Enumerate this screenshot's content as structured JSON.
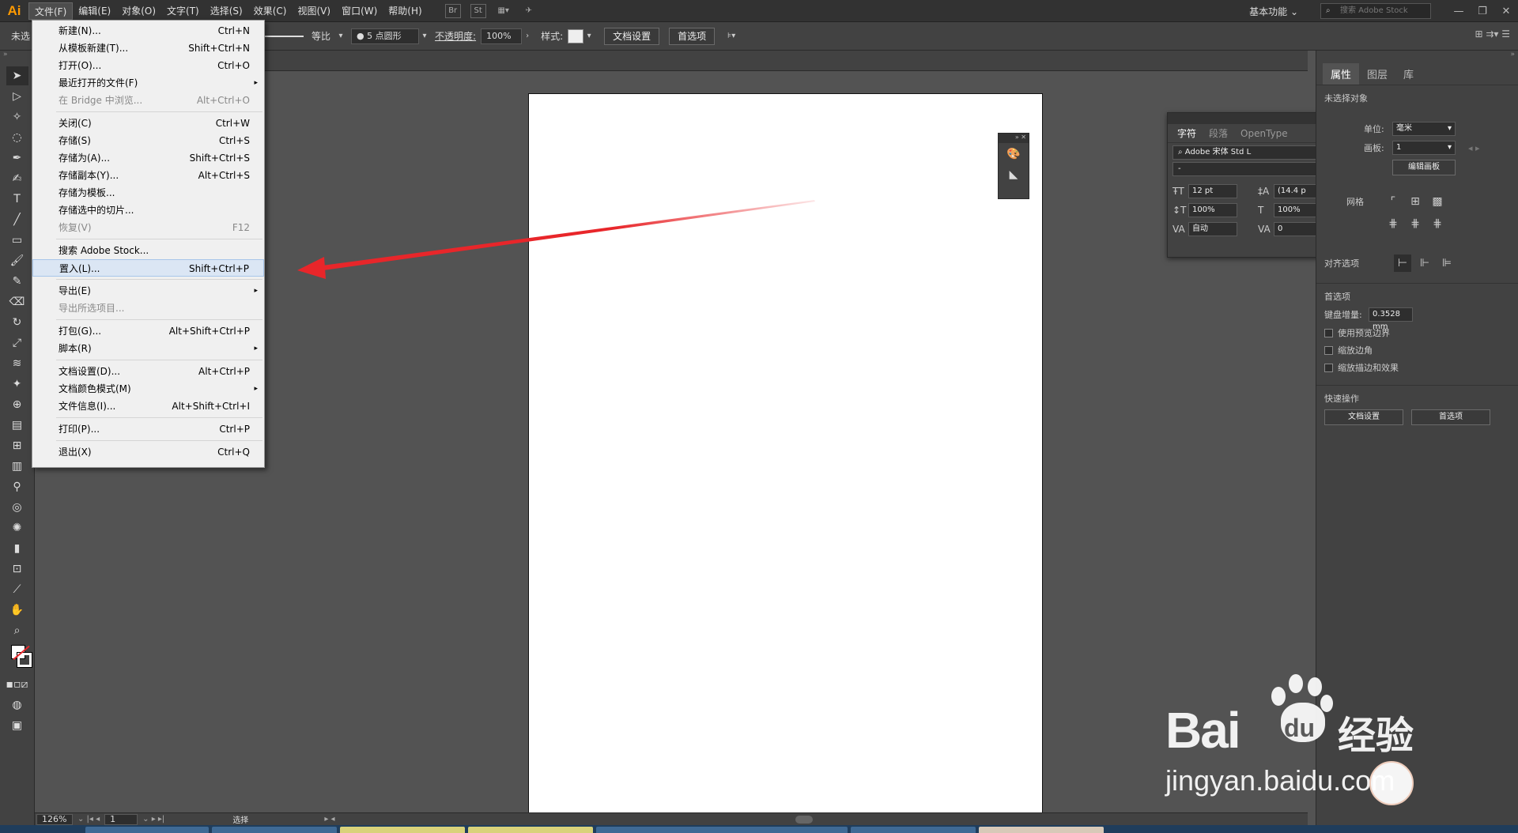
{
  "app": {
    "logo": "Ai"
  },
  "menubar": {
    "items": [
      "文件(F)",
      "编辑(E)",
      "对象(O)",
      "文字(T)",
      "选择(S)",
      "效果(C)",
      "视图(V)",
      "窗口(W)",
      "帮助(H)"
    ],
    "icons": [
      "Br",
      "St"
    ],
    "workspace": "基本功能",
    "stock_search_placeholder": "搜索 Adobe Stock"
  },
  "controlbar": {
    "no_selection": "未选",
    "stroke_profile": "等比",
    "brush": "5 点圆形",
    "opacity_label": "不透明度:",
    "opacity_value": "100%",
    "style_label": "样式:",
    "doc_setup": "文档设置",
    "prefs": "首选项"
  },
  "file_menu": {
    "groups": [
      [
        {
          "label": "新建(N)...",
          "shortcut": "Ctrl+N"
        },
        {
          "label": "从模板新建(T)...",
          "shortcut": "Shift+Ctrl+N"
        },
        {
          "label": "打开(O)...",
          "shortcut": "Ctrl+O"
        },
        {
          "label": "最近打开的文件(F)",
          "shortcut": "",
          "submenu": true
        },
        {
          "label": "在 Bridge 中浏览...",
          "shortcut": "Alt+Ctrl+O",
          "disabled": true
        }
      ],
      [
        {
          "label": "关闭(C)",
          "shortcut": "Ctrl+W"
        },
        {
          "label": "存储(S)",
          "shortcut": "Ctrl+S"
        },
        {
          "label": "存储为(A)...",
          "shortcut": "Shift+Ctrl+S"
        },
        {
          "label": "存储副本(Y)...",
          "shortcut": "Alt+Ctrl+S"
        },
        {
          "label": "存储为模板...",
          "shortcut": ""
        },
        {
          "label": "存储选中的切片...",
          "shortcut": ""
        },
        {
          "label": "恢复(V)",
          "shortcut": "F12",
          "disabled": true
        }
      ],
      [
        {
          "label": "搜索 Adobe Stock...",
          "shortcut": ""
        },
        {
          "label": "置入(L)...",
          "shortcut": "Shift+Ctrl+P",
          "highlighted": true
        }
      ],
      [
        {
          "label": "导出(E)",
          "shortcut": "",
          "submenu": true
        },
        {
          "label": "导出所选项目...",
          "shortcut": "",
          "disabled": true
        }
      ],
      [
        {
          "label": "打包(G)...",
          "shortcut": "Alt+Shift+Ctrl+P"
        },
        {
          "label": "脚本(R)",
          "shortcut": "",
          "submenu": true
        }
      ],
      [
        {
          "label": "文档设置(D)...",
          "shortcut": "Alt+Ctrl+P"
        },
        {
          "label": "文档颜色模式(M)",
          "shortcut": "",
          "submenu": true
        },
        {
          "label": "文件信息(I)...",
          "shortcut": "Alt+Shift+Ctrl+I"
        }
      ],
      [
        {
          "label": "打印(P)...",
          "shortcut": "Ctrl+P"
        }
      ],
      [
        {
          "label": "退出(X)",
          "shortcut": "Ctrl+Q"
        }
      ]
    ]
  },
  "character_panel": {
    "tabs": [
      "字符",
      "段落",
      "OpenType"
    ],
    "font": "Adobe 宋体 Std L",
    "style": "-",
    "font_size": "12 pt",
    "leading": "(14.4 p",
    "vscale": "100%",
    "hscale": "100%",
    "kerning": "自动",
    "tracking": "0"
  },
  "properties_panel": {
    "tabs": [
      "属性",
      "图层",
      "库"
    ],
    "no_selection": "未选择对象",
    "unit_label": "单位:",
    "unit_value": "毫米",
    "artboard_label": "画板:",
    "artboard_value": "1",
    "edit_artboard": "编辑画板",
    "grid_label": "网格",
    "align_label": "对齐选项",
    "prefs_title": "首选项",
    "keyboard_increment_label": "键盘增量:",
    "keyboard_increment_value": "0.3528 mm",
    "checkboxes": [
      "使用预览边界",
      "缩放边角",
      "缩放描边和效果"
    ],
    "quick_actions_title": "快速操作",
    "doc_setup": "文档设置",
    "prefs": "首选项"
  },
  "statusbar": {
    "zoom": "126%",
    "page": "1",
    "tool": "选择"
  },
  "watermark": {
    "brand": "Bai",
    "du": "du",
    "jingyan": "经验",
    "url": "jingyan.baidu.com"
  },
  "colors": {
    "accent_orange": "#ff9a00",
    "arrow_red": "#e8262a",
    "menu_highlight": "#dbe6f4"
  }
}
